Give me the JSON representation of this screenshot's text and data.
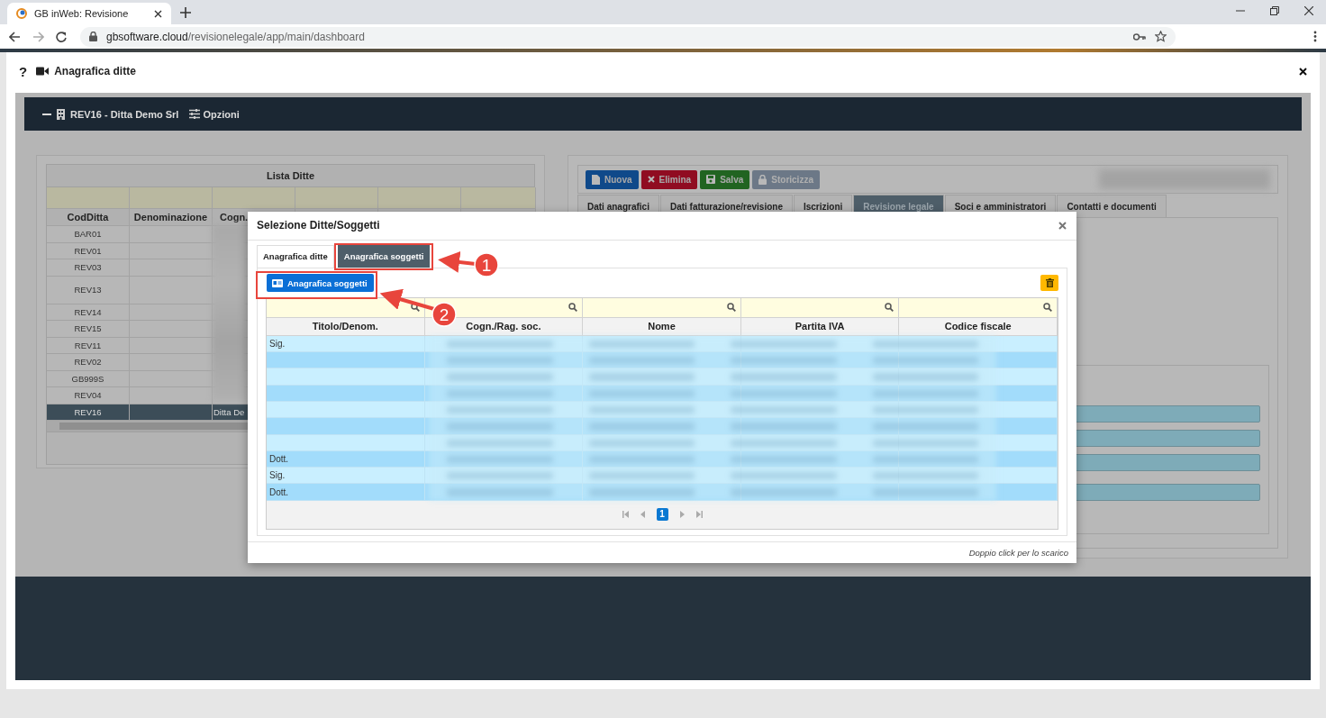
{
  "browser": {
    "tab_title": "GB inWeb: Revisione",
    "url_host": "gbsoftware.cloud",
    "url_path": "/revisionelegale/app/main/dashboard"
  },
  "window": {
    "help": "?",
    "title": "Anagrafica ditte"
  },
  "toolbar": {
    "company": "REV16 - Ditta Demo Srl",
    "options": "Opzioni"
  },
  "company_list": {
    "title": "Lista Ditte",
    "columns": [
      "CodDitta",
      "Denominazione",
      "Cogn."
    ],
    "rows": [
      {
        "code": "BAR01",
        "tall": false,
        "selected": false
      },
      {
        "code": "REV01",
        "tall": false,
        "selected": false
      },
      {
        "code": "REV03",
        "tall": false,
        "selected": false
      },
      {
        "code": "REV13",
        "tall": true,
        "selected": false
      },
      {
        "code": "REV14",
        "tall": false,
        "selected": false
      },
      {
        "code": "REV15",
        "tall": false,
        "selected": false
      },
      {
        "code": "REV11",
        "tall": false,
        "selected": false
      },
      {
        "code": "REV02",
        "tall": false,
        "selected": false
      },
      {
        "code": "GB999S",
        "tall": false,
        "selected": false
      },
      {
        "code": "REV04",
        "tall": false,
        "selected": false
      },
      {
        "code": "REV16",
        "surname": "Ditta De",
        "tall": false,
        "selected": true
      }
    ]
  },
  "actions": [
    {
      "kind": "new",
      "label": "Nuova",
      "disabled": false
    },
    {
      "kind": "delete",
      "label": "Elimina",
      "disabled": false
    },
    {
      "kind": "save",
      "label": "Salva",
      "disabled": false
    },
    {
      "kind": "archive",
      "label": "Storicizza",
      "disabled": true
    }
  ],
  "detail_tabs": [
    {
      "label": "Dati anagrafici",
      "selected": false
    },
    {
      "label": "Dati fatturazione/revisione",
      "selected": false
    },
    {
      "label": "Iscrizioni",
      "selected": false
    },
    {
      "label": "Revisione legale",
      "selected": true
    },
    {
      "label": "Soci e amministratori",
      "selected": false
    },
    {
      "label": "Contatti e documenti",
      "selected": false
    }
  ],
  "dialog": {
    "title": "Selezione Ditte/Soggetti",
    "tabs": [
      {
        "label": "Anagrafica ditte",
        "selected": false
      },
      {
        "label": "Anagrafica soggetti",
        "selected": true
      }
    ],
    "action": "Anagrafica soggetti",
    "columns": [
      "Titolo/Denom.",
      "Cogn./Rag. soc.",
      "Nome",
      "Partita IVA",
      "Codice fiscale"
    ],
    "rows": [
      {
        "title": "Sig."
      },
      {},
      {},
      {},
      {},
      {},
      {},
      {
        "title": "Dott."
      },
      {
        "title": "Sig."
      },
      {
        "title": "Dott."
      }
    ],
    "pages": [
      {
        "label": "1",
        "selected": true
      }
    ],
    "footer": "Doppio click per lo scarico"
  },
  "callouts": [
    "1",
    "2"
  ]
}
